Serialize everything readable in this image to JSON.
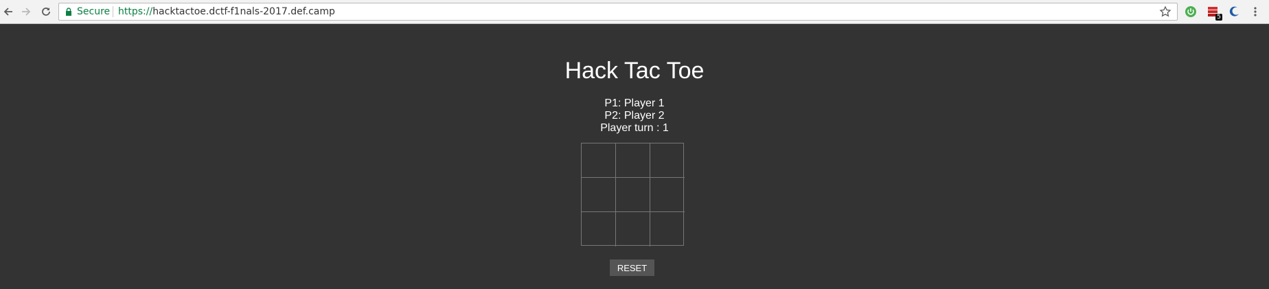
{
  "browser": {
    "security_label": "Secure",
    "url_scheme": "https://",
    "url_host": "hacktactoe.dctf-f1nals-2017.def.camp",
    "extension_badge": "5",
    "secure_color": "#0b8043"
  },
  "game": {
    "title": "Hack Tac Toe",
    "player1_line": "P1: Player 1",
    "player2_line": "P2: Player 2",
    "turn_line": "Player turn : 1",
    "reset_label": "RESET",
    "board": [
      "",
      "",
      "",
      "",
      "",
      "",
      "",
      "",
      ""
    ]
  },
  "colors": {
    "page_background": "#333333",
    "text": "#ffffff",
    "button_background": "#555555",
    "grid_line": "#777777"
  }
}
